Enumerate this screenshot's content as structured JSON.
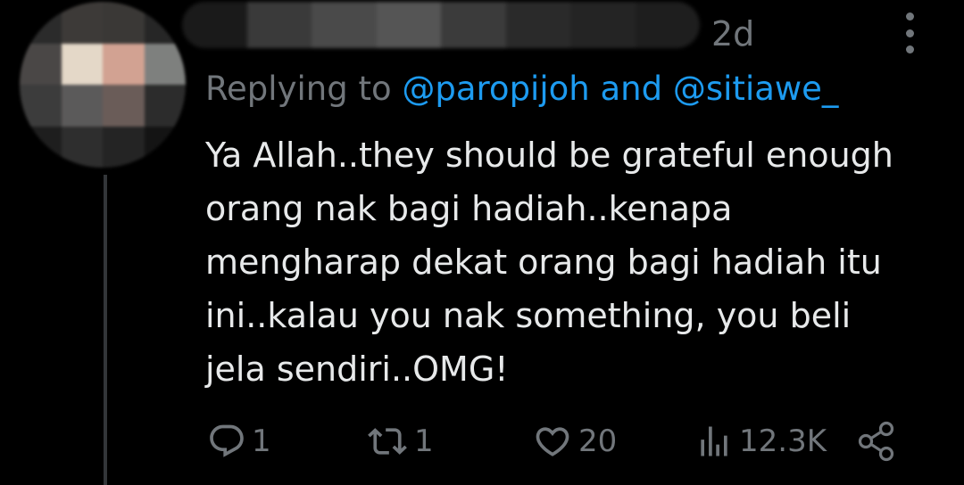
{
  "colors": {
    "background": "#000000",
    "text_primary": "#e7e9ea",
    "text_secondary": "#71767b",
    "mention": "#1d9bf0",
    "thread_line": "#333639"
  },
  "tweet": {
    "time": "2d",
    "reply_prefix": "Replying to",
    "mentions": [
      "@paropijoh",
      "@sitiawe_"
    ],
    "mention_joiner": "and",
    "text_lines": [
      "Ya Allah..they should be grateful enough",
      "orang nak bagi hadiah..kenapa",
      "mengharap dekat orang bagi hadiah itu",
      "ini..kalau you nak something, you beli",
      "jela sendiri..OMG!"
    ],
    "actions": {
      "reply_count": "1",
      "retweet_count": "1",
      "like_count": "20",
      "views_count": "12.3K"
    },
    "icons": [
      "more-icon",
      "reply-icon",
      "retweet-icon",
      "like-icon",
      "views-icon",
      "share-icon"
    ]
  }
}
